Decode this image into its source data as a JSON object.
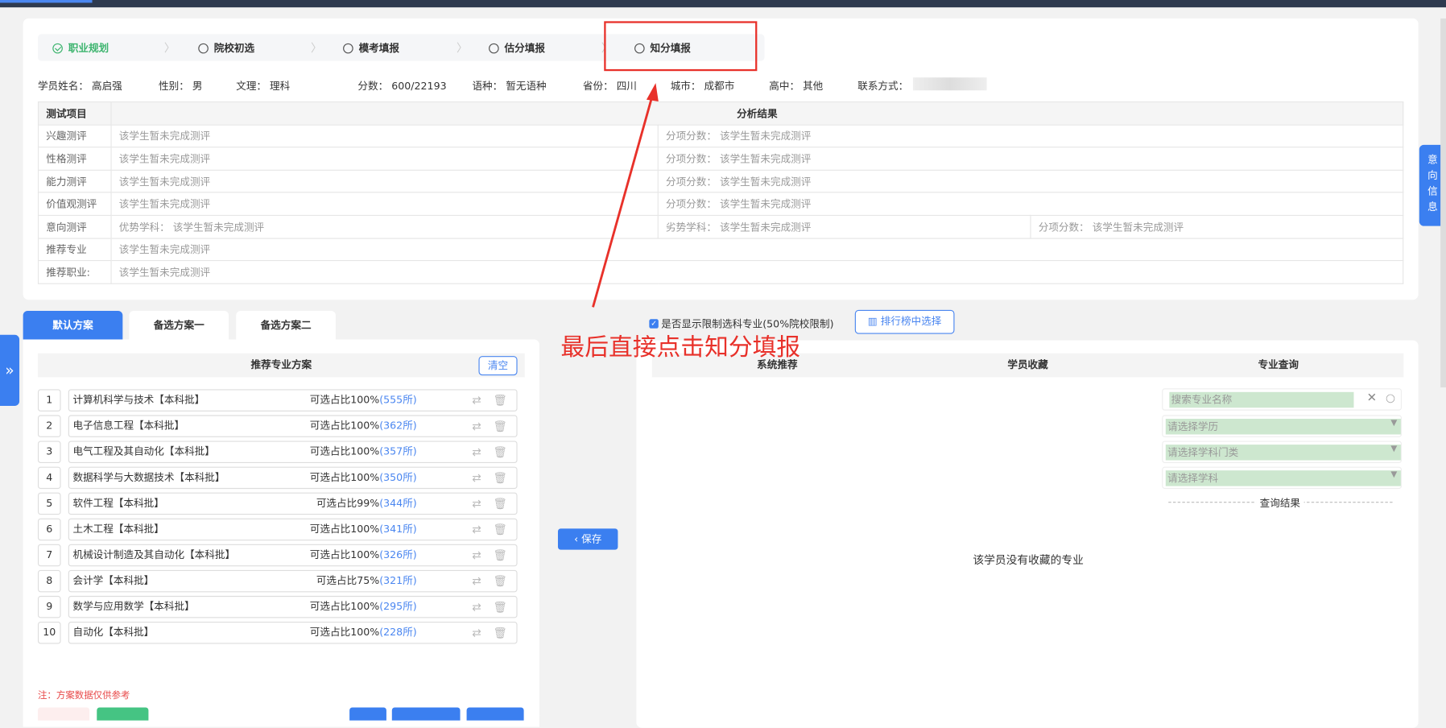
{
  "steps": [
    {
      "label": "职业规划",
      "done": true
    },
    {
      "label": "院校初选",
      "done": false
    },
    {
      "label": "模考填报",
      "done": false
    },
    {
      "label": "估分填报",
      "done": false
    },
    {
      "label": "知分填报",
      "done": false
    }
  ],
  "student": {
    "name": "学员姓名：  高启强",
    "gender": "性别：  男",
    "track": "文理：  理科",
    "score": "分数：  600/22193",
    "language": "语种：  暂无语种",
    "province": "省份：  四川",
    "city": "城市：  成都市",
    "school": "高中：  其他",
    "contact": "联系方式："
  },
  "analysis": {
    "col_item": "测试项目",
    "col_result": "分析结果",
    "rows": [
      {
        "item": "兴趣测评",
        "a": "该学生暂未完成测评",
        "b": "分项分数：  该学生暂未完成测评"
      },
      {
        "item": "性格测评",
        "a": "该学生暂未完成测评",
        "b": "分项分数：  该学生暂未完成测评"
      },
      {
        "item": "能力测评",
        "a": "该学生暂未完成测评",
        "b": "分项分数：  该学生暂未完成测评"
      },
      {
        "item": "价值观测评",
        "a": "该学生暂未完成测评",
        "b": "分项分数：  该学生暂未完成测评"
      }
    ],
    "intent": {
      "item": "意向测评",
      "a": "优势学科：  该学生暂未完成测评",
      "b": "劣势学科：  该学生暂未完成测评",
      "c": "分项分数：  该学生暂未完成测评"
    },
    "major": {
      "item": "推荐专业",
      "a": "该学生暂未完成测评"
    },
    "career": {
      "item": "推荐职业:",
      "a": "该学生暂未完成测评"
    }
  },
  "tabs": [
    "默认方案",
    "备选方案一",
    "备选方案二"
  ],
  "plan": {
    "title": "推荐专业方案",
    "clear": "清空",
    "items": [
      {
        "n": "1",
        "name": "计算机科学与技术【本科批】",
        "ratio": "可选占比100%",
        "count": "(555所)"
      },
      {
        "n": "2",
        "name": "电子信息工程【本科批】",
        "ratio": "可选占比100%",
        "count": "(362所)"
      },
      {
        "n": "3",
        "name": "电气工程及其自动化【本科批】",
        "ratio": "可选占比100%",
        "count": "(357所)"
      },
      {
        "n": "4",
        "name": "数据科学与大数据技术【本科批】",
        "ratio": "可选占比100%",
        "count": "(350所)"
      },
      {
        "n": "5",
        "name": "软件工程【本科批】",
        "ratio": "可选占比99%",
        "count": "(344所)"
      },
      {
        "n": "6",
        "name": "土木工程【本科批】",
        "ratio": "可选占比100%",
        "count": "(341所)"
      },
      {
        "n": "7",
        "name": "机械设计制造及其自动化【本科批】",
        "ratio": "可选占比100%",
        "count": "(326所)"
      },
      {
        "n": "8",
        "name": "会计学【本科批】",
        "ratio": "可选占比75%",
        "count": "(321所)"
      },
      {
        "n": "9",
        "name": "数学与应用数学【本科批】",
        "ratio": "可选占比100%",
        "count": "(295所)"
      },
      {
        "n": "10",
        "name": "自动化【本科批】",
        "ratio": "可选占比100%",
        "count": "(228所)"
      }
    ],
    "note": "注：方案数据仅供参考"
  },
  "middle": {
    "checkbox_label": "是否显示限制选科专业(50%院校限制)",
    "rank_button": "排行榜中选择",
    "save": "‹  保存"
  },
  "right": {
    "cols": [
      "系统推荐",
      "学员收藏",
      "专业查询"
    ],
    "search_placeholder": "搜索专业名称",
    "select1": "请选择学历",
    "select2": "请选择学科门类",
    "select3": "请选择学科",
    "result_label": "查询结果",
    "empty": "该学员没有收藏的专业"
  },
  "side_tab": "意\n向\n信\n息",
  "expand": "»",
  "annotation": "最后直接点击知分填报"
}
